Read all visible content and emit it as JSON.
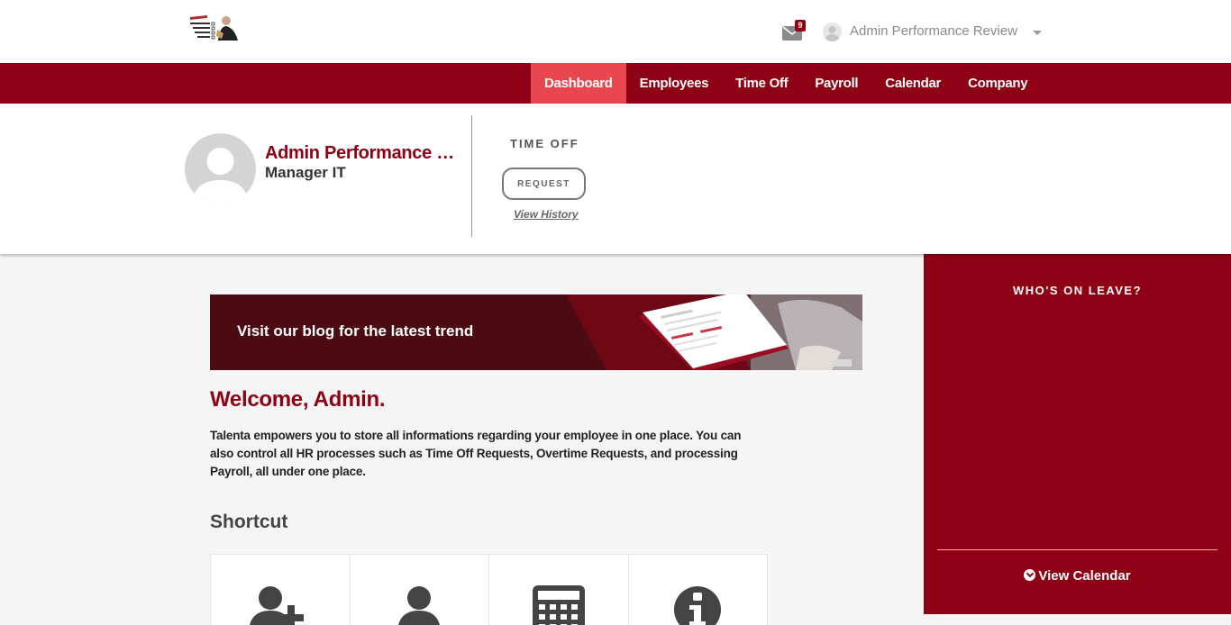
{
  "header": {
    "notification_count": "9",
    "user_name": "Admin Performance Review"
  },
  "nav": {
    "items": [
      "Dashboard",
      "Employees",
      "Time Off",
      "Payroll",
      "Calendar",
      "Company"
    ],
    "active": "Dashboard"
  },
  "profile": {
    "name": "Admin Performance Review",
    "role": "Manager IT"
  },
  "time_off": {
    "title": "TIME OFF",
    "request_label": "REQUEST",
    "history_link": "View History"
  },
  "banner": {
    "text": "Visit our blog for the latest trend"
  },
  "main": {
    "welcome": "Welcome, Admin.",
    "intro": "Talenta empowers you to store all informations regarding your employee in one place. You can also control all HR processes such as Time Off Requests, Overtime Requests, and processing Payroll, all under one place.",
    "shortcut_title": "Shortcut",
    "shortcut_icons": [
      "add-user-icon",
      "user-icon",
      "calculator-icon",
      "info-icon"
    ]
  },
  "leave_panel": {
    "title": "WHO'S ON LEAVE?",
    "view_calendar": "View Calendar"
  },
  "colors": {
    "brand": "#8e0014",
    "nav_active": "#e8474f"
  }
}
